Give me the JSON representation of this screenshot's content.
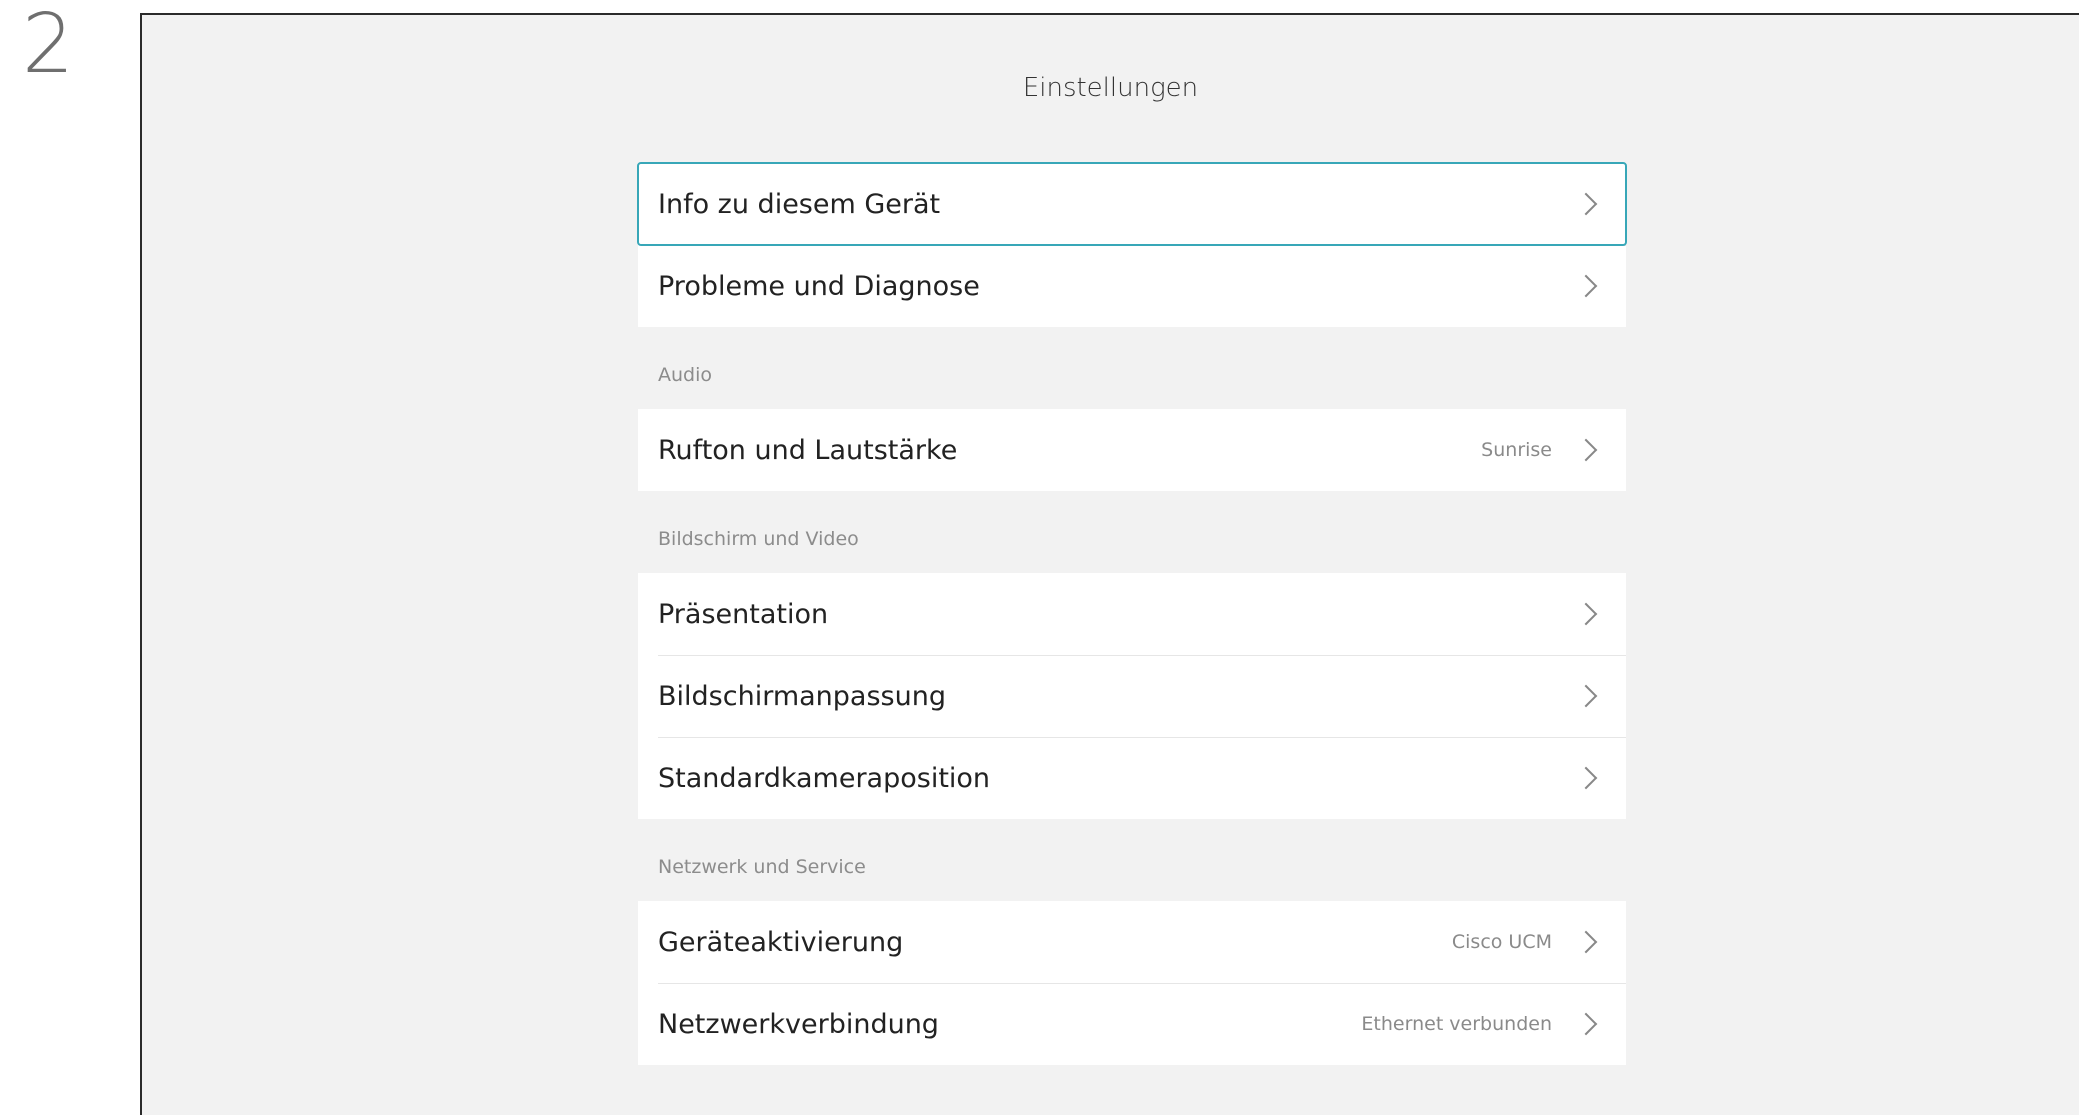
{
  "step": "2",
  "screen": {
    "title": "Einstellungen",
    "groups": [
      {
        "header": "",
        "items": [
          {
            "label": "Info zu diesem Gerät",
            "value": "",
            "selected": true
          },
          {
            "label": "Probleme und Diagnose",
            "value": ""
          }
        ]
      },
      {
        "header": "Audio",
        "items": [
          {
            "label": "Rufton und Lautstärke",
            "value": "Sunrise"
          }
        ]
      },
      {
        "header": "Bildschirm und Video",
        "items": [
          {
            "label": "Präsentation",
            "value": ""
          },
          {
            "label": "Bildschirmanpassung",
            "value": ""
          },
          {
            "label": "Standardkameraposition",
            "value": ""
          }
        ]
      },
      {
        "header": "Netzwerk und Service",
        "items": [
          {
            "label": "Geräteaktivierung",
            "value": "Cisco UCM"
          },
          {
            "label": "Netzwerkverbindung",
            "value": "Ethernet verbunden"
          }
        ]
      }
    ]
  },
  "icons": {
    "row_chevron": "chevron-right-icon"
  },
  "colors": {
    "selection_outline": "#38a7b8",
    "screen_background": "#f2f2f2"
  }
}
